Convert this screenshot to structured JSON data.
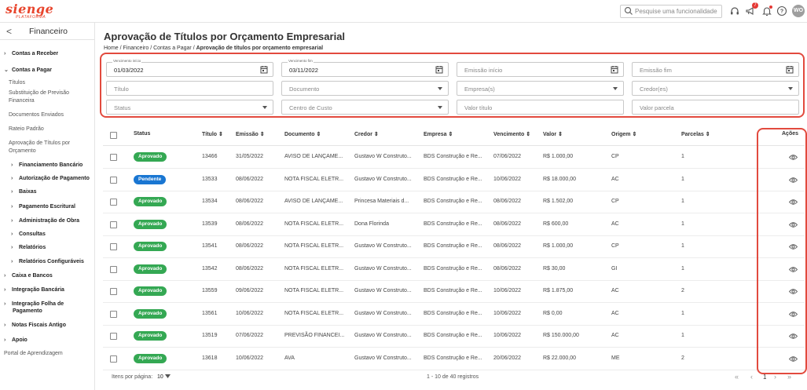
{
  "app": {
    "logo_main": "sienge",
    "logo_sub": "PLATAFORMA"
  },
  "topbar": {
    "search_placeholder": "Pesquise uma funcionalidade",
    "notification_count": "7",
    "user_initials": "WO",
    "icons": [
      "search-icon",
      "headset-icon",
      "megaphone-icon",
      "bell-icon",
      "help-icon"
    ]
  },
  "sidebar": {
    "back": "<",
    "title": "Financeiro",
    "items": [
      {
        "label": "Contas a Receber",
        "chev": "›",
        "style": "b"
      },
      {
        "label": "Contas a Pagar",
        "chev": "⌄",
        "style": "b"
      },
      {
        "label": "Títulos",
        "chev": "",
        "style": "n"
      },
      {
        "label": "Substituição de Previsão",
        "chev": "",
        "style": "n"
      },
      {
        "label": "Financeira",
        "chev": "",
        "style": "n"
      },
      {
        "label": "Documentos Enviados",
        "chev": "",
        "style": "n"
      },
      {
        "label": "Rateio Padrão",
        "chev": "",
        "style": "n"
      },
      {
        "label": "Aprovação de Títulos por",
        "chev": "",
        "style": "n"
      },
      {
        "label": "Orçamento",
        "chev": "",
        "style": "n"
      },
      {
        "label": "Financiamento Bancário",
        "chev": "›",
        "style": "b"
      },
      {
        "label": "Autorização de Pagamento",
        "chev": "›",
        "style": "b"
      },
      {
        "label": "Baixas",
        "chev": "›",
        "style": "b"
      },
      {
        "label": "Pagamento Escritural",
        "chev": "›",
        "style": "b"
      },
      {
        "label": "Administração de Obra",
        "chev": "›",
        "style": "b"
      },
      {
        "label": "Consultas",
        "chev": "›",
        "style": "b"
      },
      {
        "label": "Relatórios",
        "chev": "›",
        "style": "b"
      },
      {
        "label": "Relatórios Configuráveis",
        "chev": "›",
        "style": "b"
      },
      {
        "label": "Caixa e Bancos",
        "chev": "›",
        "style": "b"
      },
      {
        "label": "Integração Bancária",
        "chev": "›",
        "style": "b"
      },
      {
        "label": "Integração Folha de",
        "chev": "›",
        "style": "b"
      },
      {
        "label": "Pagamento",
        "chev": "",
        "style": "b"
      },
      {
        "label": "Notas Fiscais Antigo",
        "chev": "›",
        "style": "b"
      },
      {
        "label": "Apoio",
        "chev": "›",
        "style": "b"
      },
      {
        "label": "Portal de Aprendizagem",
        "chev": "",
        "style": "n"
      }
    ]
  },
  "page": {
    "title": "Aprovação de Títulos por Orçamento Empresarial",
    "breadcrumb": {
      "home": "Home",
      "sep": "/",
      "financeiro": "Financeiro",
      "contas": "Contas a Pagar",
      "current": "Aprovação de títulos por orçamento empresarial"
    }
  },
  "filters": {
    "vencimento_inicio": {
      "label": "Vencimento início",
      "value": "01/03/2022"
    },
    "vencimento_fim": {
      "label": "Vencimento fim",
      "value": "03/11/2022"
    },
    "emissao_inicio": "Emissão início",
    "emissao_fim": "Emissão fim",
    "titulo": "Título",
    "documento": "Documento",
    "empresas": "Empresa(s)",
    "credores": "Credor(es)",
    "status": "Status",
    "centro_custo": "Centro de Custo",
    "valor_titulo": "Valor título",
    "valor_parcela": "Valor parcela"
  },
  "table": {
    "headers": {
      "status": "Status",
      "titulo": "Título ⇕",
      "emissao": "Emissão ⇕",
      "documento": "Documento ⇕",
      "credor": "Credor ⇕",
      "empresa": "Empresa ⇕",
      "vencimento": "Vencimento ⇕",
      "valor": "Valor ⇕",
      "origem": "Origem ⇕",
      "parcelas": "Parcelas ⇕",
      "acoes": "Ações"
    },
    "rows": [
      {
        "status": "Aprovado",
        "kind": "ap",
        "titulo": "13466",
        "emissao": "31/05/2022",
        "documento": "AVISO DE LANÇAME...",
        "credor": "Gustavo W Construto...",
        "empresa": "BDS Construção e Re...",
        "vencimento": "07/06/2022",
        "valor": "R$ 1.000,00",
        "origem": "CP",
        "parcelas": "1"
      },
      {
        "status": "Pendente",
        "kind": "pe",
        "titulo": "13533",
        "emissao": "08/06/2022",
        "documento": "NOTA FISCAL ELETR...",
        "credor": "Gustavo W Construto...",
        "empresa": "BDS Construção e Re...",
        "vencimento": "10/06/2022",
        "valor": "R$ 18.000,00",
        "origem": "AC",
        "parcelas": "1"
      },
      {
        "status": "Aprovado",
        "kind": "ap",
        "titulo": "13534",
        "emissao": "08/06/2022",
        "documento": "AVISO DE LANÇAME...",
        "credor": "Princesa Materiais d...",
        "empresa": "BDS Construção e Re...",
        "vencimento": "08/06/2022",
        "valor": "R$ 1.502,00",
        "origem": "CP",
        "parcelas": "1"
      },
      {
        "status": "Aprovado",
        "kind": "ap",
        "titulo": "13539",
        "emissao": "08/06/2022",
        "documento": "NOTA FISCAL ELETR...",
        "credor": "Dona Florinda",
        "empresa": "BDS Construção e Re...",
        "vencimento": "08/06/2022",
        "valor": "R$ 600,00",
        "origem": "AC",
        "parcelas": "1"
      },
      {
        "status": "Aprovado",
        "kind": "ap",
        "titulo": "13541",
        "emissao": "08/06/2022",
        "documento": "NOTA FISCAL ELETR...",
        "credor": "Gustavo W Construto...",
        "empresa": "BDS Construção e Re...",
        "vencimento": "08/06/2022",
        "valor": "R$ 1.000,00",
        "origem": "CP",
        "parcelas": "1"
      },
      {
        "status": "Aprovado",
        "kind": "ap",
        "titulo": "13542",
        "emissao": "08/06/2022",
        "documento": "NOTA FISCAL ELETR...",
        "credor": "Gustavo W Construto...",
        "empresa": "BDS Construção e Re...",
        "vencimento": "08/06/2022",
        "valor": "R$ 30,00",
        "origem": "GI",
        "parcelas": "1"
      },
      {
        "status": "Aprovado",
        "kind": "ap",
        "titulo": "13559",
        "emissao": "09/06/2022",
        "documento": "NOTA FISCAL ELETR...",
        "credor": "Gustavo W Construto...",
        "empresa": "BDS Construção e Re...",
        "vencimento": "10/06/2022",
        "valor": "R$ 1.875,00",
        "origem": "AC",
        "parcelas": "2"
      },
      {
        "status": "Aprovado",
        "kind": "ap",
        "titulo": "13561",
        "emissao": "10/06/2022",
        "documento": "NOTA FISCAL ELETR...",
        "credor": "Gustavo W Construto...",
        "empresa": "BDS Construção e Re...",
        "vencimento": "10/06/2022",
        "valor": "R$ 0,00",
        "origem": "AC",
        "parcelas": "1"
      },
      {
        "status": "Aprovado",
        "kind": "ap",
        "titulo": "13519",
        "emissao": "07/06/2022",
        "documento": "PREVISÃO FINANCEI...",
        "credor": "Gustavo W Construto...",
        "empresa": "BDS Construção e Re...",
        "vencimento": "10/06/2022",
        "valor": "R$ 150.000,00",
        "origem": "AC",
        "parcelas": "1"
      },
      {
        "status": "Aprovado",
        "kind": "ap",
        "titulo": "13618",
        "emissao": "10/06/2022",
        "documento": "AVA",
        "credor": "Gustavo W Construto...",
        "empresa": "BDS Construção e Re...",
        "vencimento": "20/06/2022",
        "valor": "R$ 22.000,00",
        "origem": "ME",
        "parcelas": "2"
      }
    ]
  },
  "footer": {
    "per_page_label": "Itens por página:",
    "per_page_value": "10",
    "range": "1 - 10 de 40 registros",
    "first": "«",
    "prev": "‹",
    "page": "1",
    "next": "›",
    "last": "»"
  },
  "colors": {
    "brand": "#e8452d",
    "highlight": "#e24a3e",
    "approved": "#34a853",
    "pending": "#1976d2"
  }
}
